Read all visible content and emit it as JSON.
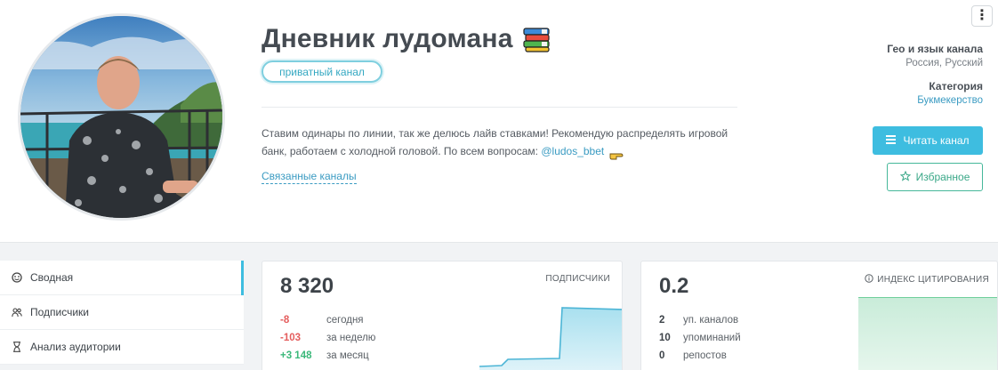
{
  "channel": {
    "title": "Дневник лудомана",
    "badge": "приватный канал",
    "description": "Ставим одинары по линии, так же делюсь лайв ставками! Рекомендую распределять игровой банк, работаем с холодной головой. По всем вопросам: ",
    "mention": "@ludos_bbet",
    "related_link": "Связанные каналы"
  },
  "meta": {
    "geo_label": "Гео и язык канала",
    "geo_value": "Россия, Русский",
    "category_label": "Категория",
    "category_value": "Букмекерство"
  },
  "actions": {
    "read_label": "Читать канал",
    "favorite_label": "Избранное",
    "menu_glyph": "⋮"
  },
  "sidebar": {
    "items": [
      {
        "label": "Сводная",
        "icon": "dashboard-icon",
        "active": true
      },
      {
        "label": "Подписчики",
        "icon": "users-icon",
        "active": false
      },
      {
        "label": "Анализ аудитории",
        "icon": "hourglass-icon",
        "active": false
      }
    ]
  },
  "subscribers_card": {
    "value": "8 320",
    "label": "ПОДПИСЧИКИ",
    "rows": [
      {
        "num": "-8",
        "text": "сегодня"
      },
      {
        "num": "-103",
        "text": "за неделю"
      },
      {
        "num": "+3 148",
        "text": "за месяц"
      }
    ]
  },
  "citation_card": {
    "value": "0.2",
    "label": "ИНДЕКС ЦИТИРОВАНИЯ",
    "rows": [
      {
        "num": "2",
        "text": "уп. каналов"
      },
      {
        "num": "10",
        "text": "упоминаний"
      },
      {
        "num": "0",
        "text": "репостов"
      }
    ]
  },
  "colors": {
    "accent": "#3ebde0",
    "favorite": "#46b89a",
    "negative": "#e45c5c",
    "positive": "#3bb87a"
  }
}
